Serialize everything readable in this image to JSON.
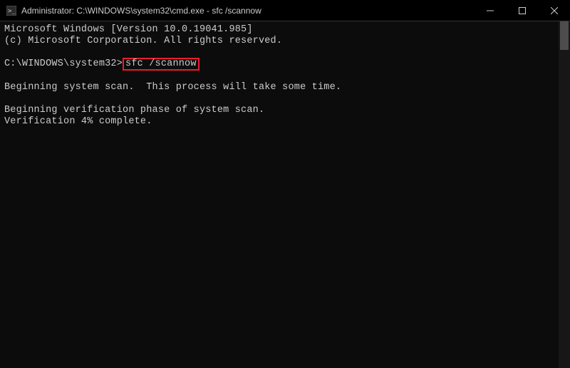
{
  "window": {
    "title": "Administrator: C:\\WINDOWS\\system32\\cmd.exe - sfc  /scannow",
    "icon": "cmd-icon"
  },
  "controls": {
    "minimize": "minimize",
    "maximize": "maximize",
    "close": "close"
  },
  "terminal": {
    "version_line": "Microsoft Windows [Version 10.0.19041.985]",
    "copyright_line": "(c) Microsoft Corporation. All rights reserved.",
    "prompt_prefix": "C:\\WINDOWS\\system32>",
    "command": "sfc /scannow",
    "scan_begin": "Beginning system scan.  This process will take some time.",
    "verify_begin": "Beginning verification phase of system scan.",
    "verify_progress": "Verification 4% complete."
  },
  "colors": {
    "highlight_border": "#e81d2e",
    "text": "#cccccc",
    "background": "#0c0c0c"
  }
}
